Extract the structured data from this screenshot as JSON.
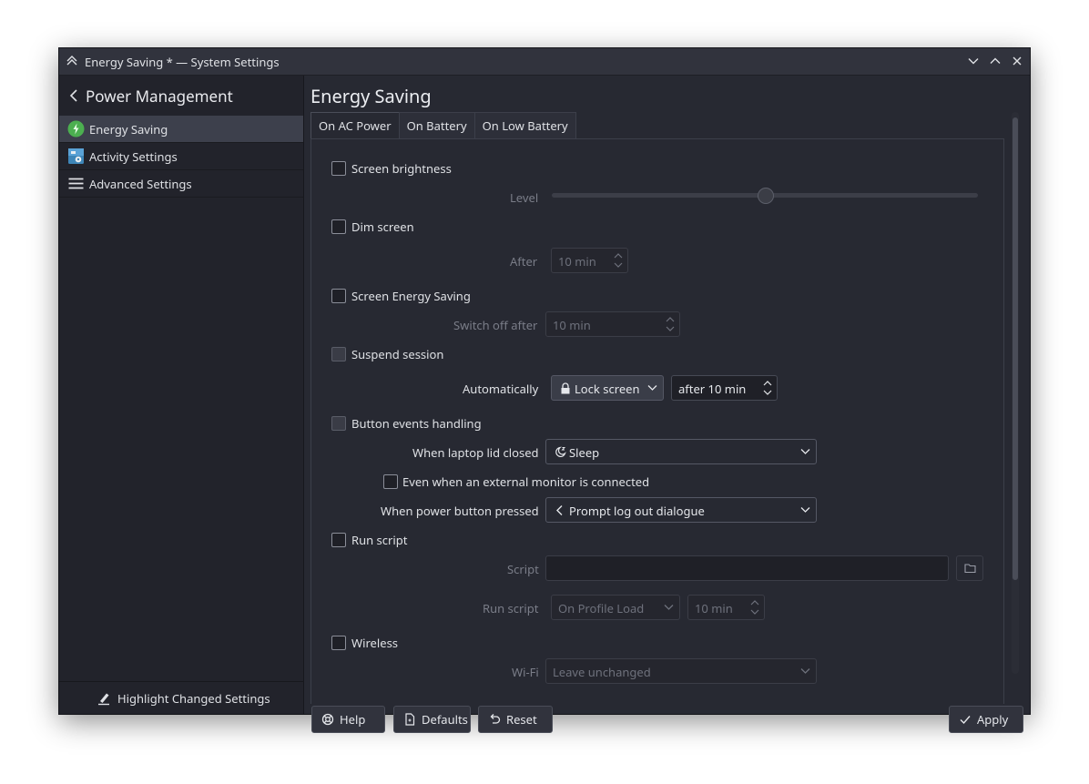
{
  "window": {
    "title": "Energy Saving * — System Settings",
    "icons": [
      "kde-app-icon",
      "minimize-icon",
      "maximize-icon",
      "close-icon"
    ]
  },
  "sidebar": {
    "title": "Power Management",
    "items": [
      {
        "label": "Energy Saving",
        "icon": "energy-saving-icon",
        "active": true
      },
      {
        "label": "Activity Settings",
        "icon": "activity-settings-icon",
        "active": false
      },
      {
        "label": "Advanced Settings",
        "icon": "hamburger-menu-icon",
        "active": false
      }
    ],
    "footer": "Highlight Changed Settings"
  },
  "main": {
    "title": "Energy Saving",
    "tabs": [
      "On AC Power",
      "On Battery",
      "On Low Battery"
    ],
    "active_tab": "On AC Power"
  },
  "form": {
    "screen_brightness": {
      "label": "Screen brightness",
      "checked": false,
      "level_label": "Level",
      "level_fraction": 0.5
    },
    "dim_screen": {
      "label": "Dim screen",
      "checked": false,
      "after_label": "After",
      "after_value": "10 min"
    },
    "screen_energy_saving": {
      "label": "Screen Energy Saving",
      "checked": false,
      "switch_off_label": "Switch off after",
      "switch_off_value": "10 min"
    },
    "suspend_session": {
      "label": "Suspend session",
      "automatically_label": "Automatically",
      "action": "Lock screen",
      "after_value": "after 10 min"
    },
    "button_events": {
      "label": "Button events handling",
      "lid_closed_label": "When laptop lid closed",
      "lid_closed_value": "Sleep",
      "external_monitor_label": "Even when an external monitor is connected",
      "power_button_label": "When power button pressed",
      "power_button_value": "Prompt log out dialogue"
    },
    "run_script": {
      "label": "Run script",
      "checked": false,
      "script_label": "Script",
      "script_value": "",
      "when_label": "Run script",
      "when_value": "On Profile Load",
      "time_value": "10 min"
    },
    "wireless": {
      "label": "Wireless",
      "checked": false,
      "wifi_label": "Wi-Fi",
      "wifi_value": "Leave unchanged"
    }
  },
  "buttons": {
    "help": "Help",
    "defaults": "Defaults",
    "reset": "Reset",
    "apply": "Apply"
  },
  "colors": {
    "window_bg": "#272932",
    "sidebar_bg": "#22232b",
    "active_item": "#3d404c",
    "energy_icon_green": "#4caf50"
  }
}
